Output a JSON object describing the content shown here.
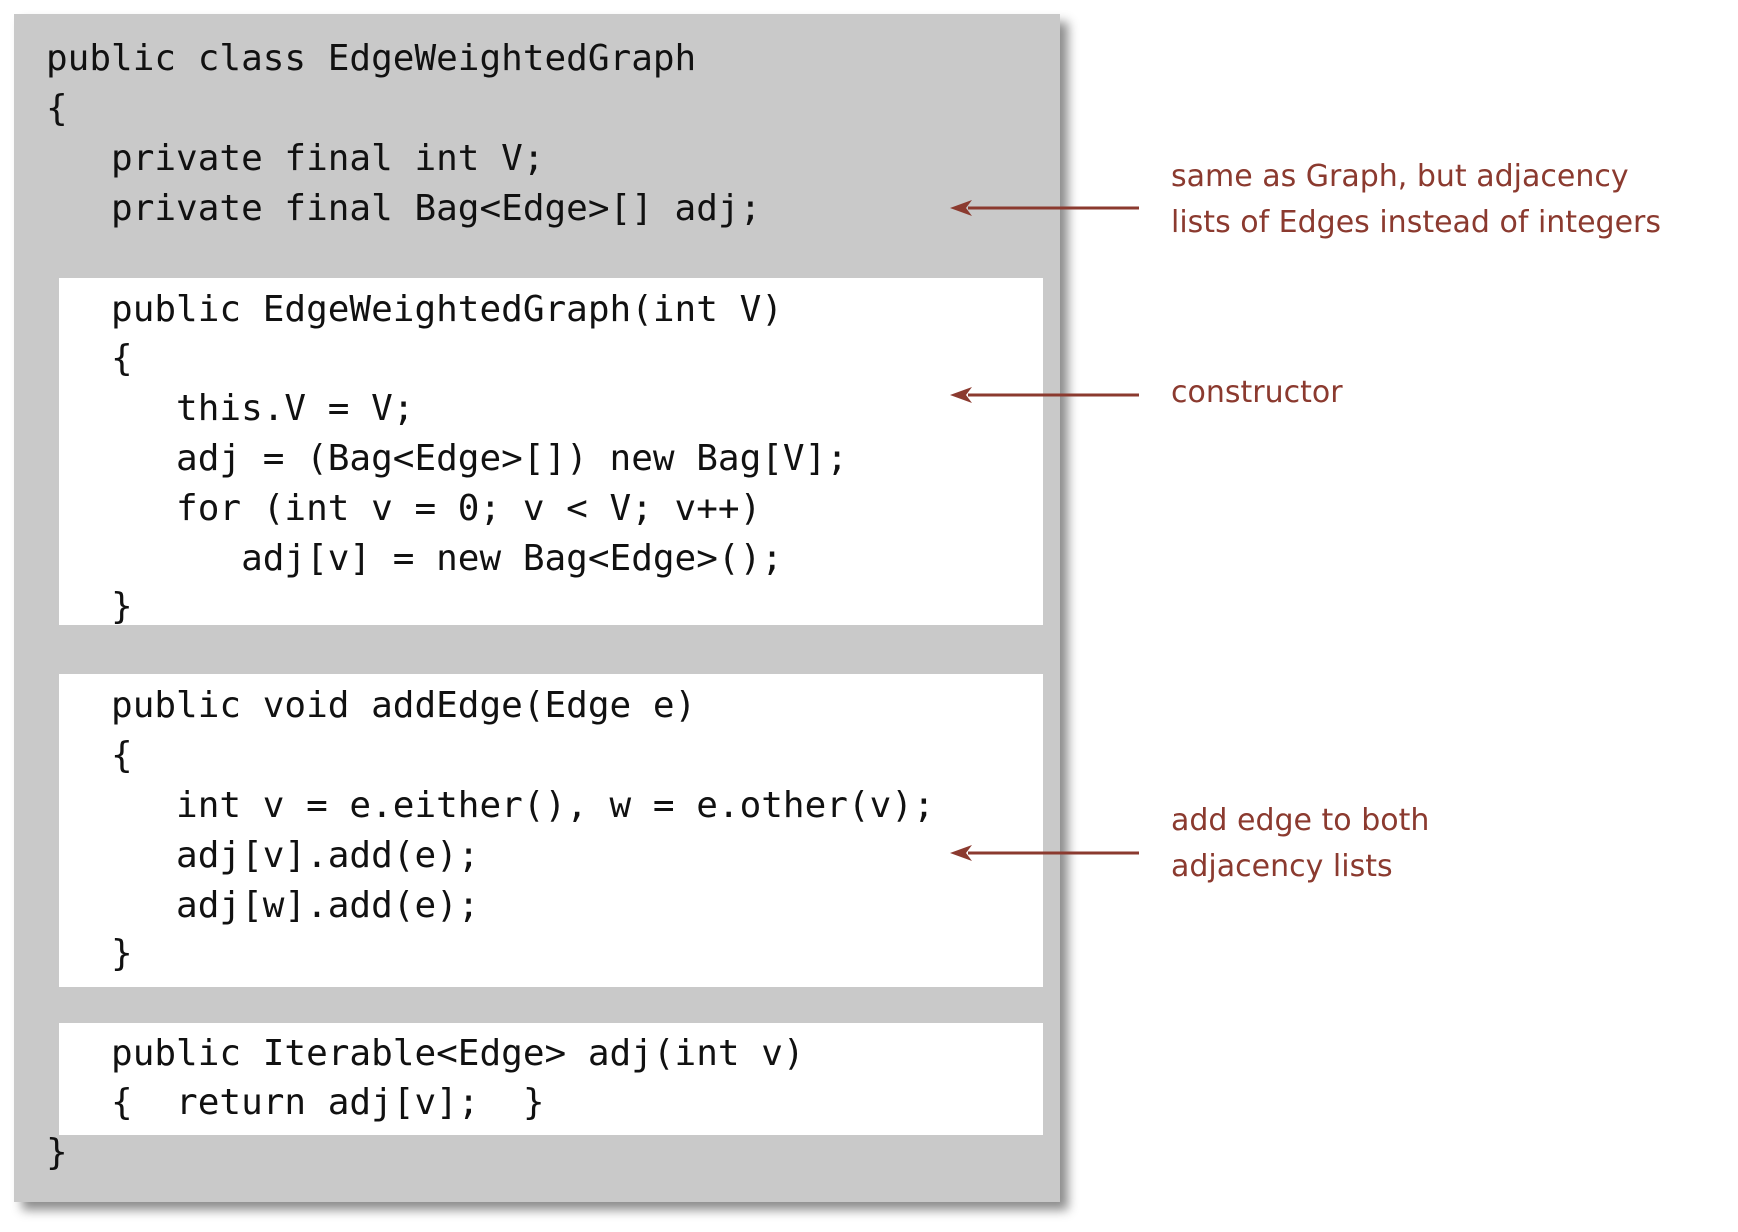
{
  "code": {
    "class_header": {
      "lines": [
        "public class EdgeWeightedGraph",
        "{",
        "   private final int V;",
        "   private final Bag<Edge>[] adj;"
      ]
    },
    "constructor": {
      "lines": [
        "   public EdgeWeightedGraph(int V)",
        "   {",
        "      this.V = V;",
        "      adj = (Bag<Edge>[]) new Bag[V];",
        "      for (int v = 0; v < V; v++)",
        "         adj[v] = new Bag<Edge>();",
        "   }"
      ]
    },
    "add_edge": {
      "lines": [
        "   public void addEdge(Edge e)",
        "   {",
        "      int v = e.either(), w = e.other(v);",
        "      adj[v].add(e);",
        "      adj[w].add(e);",
        "   }"
      ]
    },
    "adj_method": {
      "lines": [
        "   public Iterable<Edge> adj(int v)",
        "   {  return adj[v];  }"
      ]
    },
    "closing": {
      "lines": [
        "}"
      ]
    }
  },
  "annotations": {
    "fields_note": "same as Graph, but adjacency\nlists of Edges instead of integers",
    "constructor_note": "constructor",
    "add_edge_note": "add edge to both\nadjacency lists"
  },
  "colors": {
    "annotation": "#8b3a2f",
    "panel": "#c9c9c9",
    "highlight_block": "#ffffff",
    "code_text": "#111111"
  }
}
